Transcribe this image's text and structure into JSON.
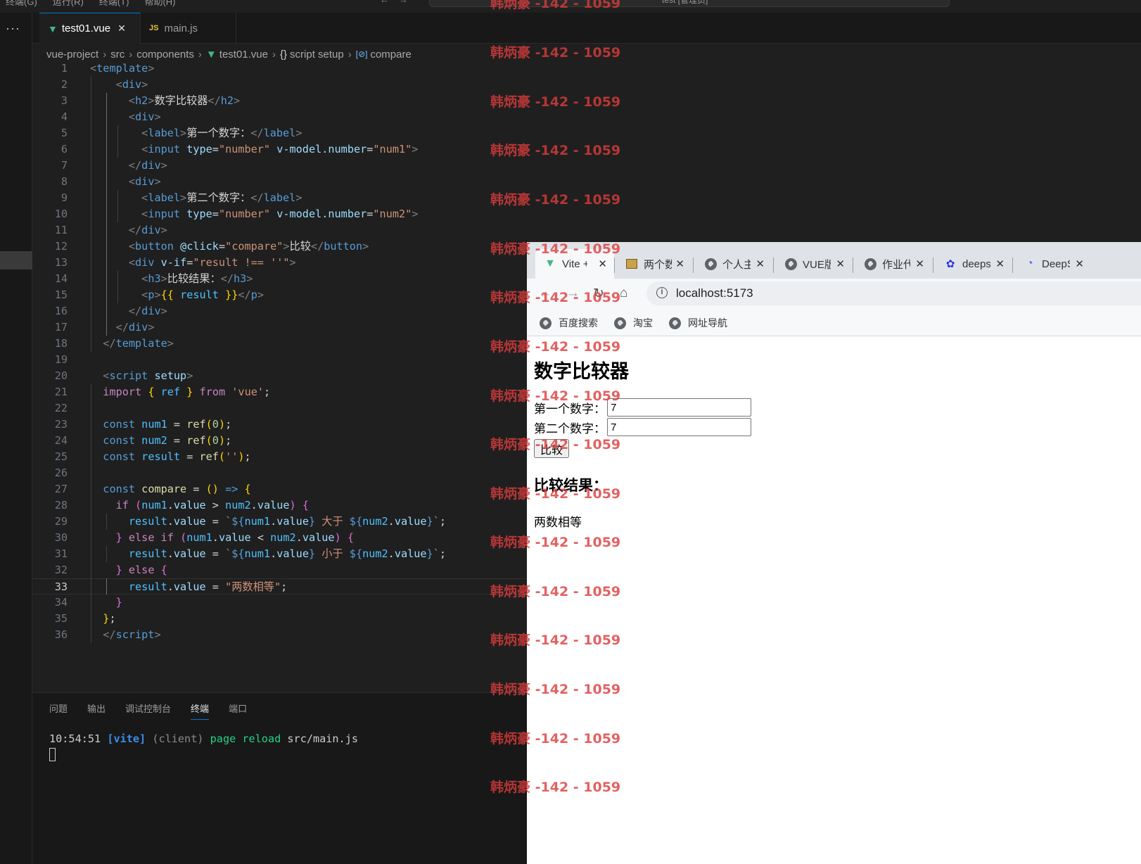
{
  "vscode": {
    "menubar": {
      "items": [
        "终端(G)",
        "运行(R)",
        "终端(T)",
        "帮助(H)"
      ],
      "command_center": "test [管理员]"
    },
    "tabs": [
      {
        "label": "test01.vue",
        "icon": "vue-icon",
        "active": true
      },
      {
        "label": "main.js",
        "icon": "js-icon",
        "active": false
      }
    ],
    "breadcrumb": [
      "vue-project",
      "src",
      "components",
      "test01.vue",
      "script setup",
      "compare"
    ],
    "current_line": 33,
    "panel": {
      "tabs": [
        "问题",
        "输出",
        "调试控制台",
        "终端",
        "端口"
      ],
      "active_tab": "终端",
      "terminal": {
        "time": "10:54:51",
        "tag": "[vite]",
        "client": "(client)",
        "action": "page reload",
        "path": "src/main.js"
      }
    }
  },
  "code": {
    "line_numbers": [
      "1",
      "2",
      "3",
      "4",
      "5",
      "6",
      "7",
      "8",
      "9",
      "10",
      "11",
      "12",
      "13",
      "14",
      "15",
      "16",
      "17",
      "18",
      "19",
      "20",
      "21",
      "22",
      "23",
      "24",
      "25",
      "26",
      "27",
      "28",
      "29",
      "30",
      "31",
      "32",
      "33",
      "34",
      "35",
      "36"
    ],
    "lines": [
      [
        [
          "c-br",
          "<"
        ],
        [
          "c-tag",
          "template"
        ],
        [
          "c-br",
          ">"
        ]
      ],
      [
        [
          "c-txt",
          "    "
        ],
        [
          "c-br",
          "<"
        ],
        [
          "c-tag",
          "div"
        ],
        [
          "c-br",
          ">"
        ]
      ],
      [
        [
          "c-txt",
          "      "
        ],
        [
          "c-br",
          "<"
        ],
        [
          "c-tag",
          "h2"
        ],
        [
          "c-br",
          ">"
        ],
        [
          "c-txt",
          "数字比较器"
        ],
        [
          "c-br",
          "</"
        ],
        [
          "c-tag",
          "h2"
        ],
        [
          "c-br",
          ">"
        ]
      ],
      [
        [
          "c-txt",
          "      "
        ],
        [
          "c-br",
          "<"
        ],
        [
          "c-tag",
          "div"
        ],
        [
          "c-br",
          ">"
        ]
      ],
      [
        [
          "c-txt",
          "        "
        ],
        [
          "c-br",
          "<"
        ],
        [
          "c-tag",
          "label"
        ],
        [
          "c-br",
          ">"
        ],
        [
          "c-txt",
          "第一个数字："
        ],
        [
          "c-br",
          "</"
        ],
        [
          "c-tag",
          "label"
        ],
        [
          "c-br",
          ">"
        ]
      ],
      [
        [
          "c-txt",
          "        "
        ],
        [
          "c-br",
          "<"
        ],
        [
          "c-tag",
          "input"
        ],
        [
          "c-txt",
          " "
        ],
        [
          "c-attr",
          "type"
        ],
        [
          "c-txt",
          "="
        ],
        [
          "c-str",
          "\"number\""
        ],
        [
          "c-txt",
          " "
        ],
        [
          "c-attr",
          "v-model.number"
        ],
        [
          "c-txt",
          "="
        ],
        [
          "c-str",
          "\"num1\""
        ],
        [
          "c-br",
          ">"
        ]
      ],
      [
        [
          "c-txt",
          "      "
        ],
        [
          "c-br",
          "</"
        ],
        [
          "c-tag",
          "div"
        ],
        [
          "c-br",
          ">"
        ]
      ],
      [
        [
          "c-txt",
          "      "
        ],
        [
          "c-br",
          "<"
        ],
        [
          "c-tag",
          "div"
        ],
        [
          "c-br",
          ">"
        ]
      ],
      [
        [
          "c-txt",
          "        "
        ],
        [
          "c-br",
          "<"
        ],
        [
          "c-tag",
          "label"
        ],
        [
          "c-br",
          ">"
        ],
        [
          "c-txt",
          "第二个数字："
        ],
        [
          "c-br",
          "</"
        ],
        [
          "c-tag",
          "label"
        ],
        [
          "c-br",
          ">"
        ]
      ],
      [
        [
          "c-txt",
          "        "
        ],
        [
          "c-br",
          "<"
        ],
        [
          "c-tag",
          "input"
        ],
        [
          "c-txt",
          " "
        ],
        [
          "c-attr",
          "type"
        ],
        [
          "c-txt",
          "="
        ],
        [
          "c-str",
          "\"number\""
        ],
        [
          "c-txt",
          " "
        ],
        [
          "c-attr",
          "v-model.number"
        ],
        [
          "c-txt",
          "="
        ],
        [
          "c-str",
          "\"num2\""
        ],
        [
          "c-br",
          ">"
        ]
      ],
      [
        [
          "c-txt",
          "      "
        ],
        [
          "c-br",
          "</"
        ],
        [
          "c-tag",
          "div"
        ],
        [
          "c-br",
          ">"
        ]
      ],
      [
        [
          "c-txt",
          "      "
        ],
        [
          "c-br",
          "<"
        ],
        [
          "c-tag",
          "button"
        ],
        [
          "c-txt",
          " "
        ],
        [
          "c-attr",
          "@click"
        ],
        [
          "c-txt",
          "="
        ],
        [
          "c-str",
          "\"compare\""
        ],
        [
          "c-br",
          ">"
        ],
        [
          "c-txt",
          "比较"
        ],
        [
          "c-br",
          "</"
        ],
        [
          "c-tag",
          "button"
        ],
        [
          "c-br",
          ">"
        ]
      ],
      [
        [
          "c-txt",
          "      "
        ],
        [
          "c-br",
          "<"
        ],
        [
          "c-tag",
          "div"
        ],
        [
          "c-txt",
          " "
        ],
        [
          "c-attr",
          "v-if"
        ],
        [
          "c-txt",
          "="
        ],
        [
          "c-str",
          "\"result !== ''\""
        ],
        [
          "c-br",
          ">"
        ]
      ],
      [
        [
          "c-txt",
          "        "
        ],
        [
          "c-br",
          "<"
        ],
        [
          "c-tag",
          "h3"
        ],
        [
          "c-br",
          ">"
        ],
        [
          "c-txt",
          "比较结果："
        ],
        [
          "c-br",
          "</"
        ],
        [
          "c-tag",
          "h3"
        ],
        [
          "c-br",
          ">"
        ]
      ],
      [
        [
          "c-txt",
          "        "
        ],
        [
          "c-br",
          "<"
        ],
        [
          "c-tag",
          "p"
        ],
        [
          "c-br",
          ">"
        ],
        [
          "c-y",
          "{{"
        ],
        [
          "c-txt",
          " "
        ],
        [
          "c-var",
          "result"
        ],
        [
          "c-txt",
          " "
        ],
        [
          "c-y",
          "}}"
        ],
        [
          "c-br",
          "</"
        ],
        [
          "c-tag",
          "p"
        ],
        [
          "c-br",
          ">"
        ]
      ],
      [
        [
          "c-txt",
          "      "
        ],
        [
          "c-br",
          "</"
        ],
        [
          "c-tag",
          "div"
        ],
        [
          "c-br",
          ">"
        ]
      ],
      [
        [
          "c-txt",
          "    "
        ],
        [
          "c-br",
          "</"
        ],
        [
          "c-tag",
          "div"
        ],
        [
          "c-br",
          ">"
        ]
      ],
      [
        [
          "c-txt",
          "  "
        ],
        [
          "c-br",
          "</"
        ],
        [
          "c-tag",
          "template"
        ],
        [
          "c-br",
          ">"
        ]
      ],
      [],
      [
        [
          "c-txt",
          "  "
        ],
        [
          "c-br",
          "<"
        ],
        [
          "c-tag",
          "script"
        ],
        [
          "c-txt",
          " "
        ],
        [
          "c-attr",
          "setup"
        ],
        [
          "c-br",
          ">"
        ]
      ],
      [
        [
          "c-txt",
          "  "
        ],
        [
          "c-ctl",
          "import"
        ],
        [
          "c-txt",
          " "
        ],
        [
          "c-y",
          "{"
        ],
        [
          "c-txt",
          " "
        ],
        [
          "c-var",
          "ref"
        ],
        [
          "c-txt",
          " "
        ],
        [
          "c-y",
          "}"
        ],
        [
          "c-txt",
          " "
        ],
        [
          "c-ctl",
          "from"
        ],
        [
          "c-txt",
          " "
        ],
        [
          "c-str",
          "'vue'"
        ],
        [
          "c-txt",
          ";"
        ]
      ],
      [],
      [
        [
          "c-txt",
          "  "
        ],
        [
          "c-kw",
          "const"
        ],
        [
          "c-txt",
          " "
        ],
        [
          "c-var",
          "num1"
        ],
        [
          "c-txt",
          " = "
        ],
        [
          "c-fn",
          "ref"
        ],
        [
          "c-y",
          "("
        ],
        [
          "c-num",
          "0"
        ],
        [
          "c-y",
          ")"
        ],
        [
          "c-txt",
          ";"
        ]
      ],
      [
        [
          "c-txt",
          "  "
        ],
        [
          "c-kw",
          "const"
        ],
        [
          "c-txt",
          " "
        ],
        [
          "c-var",
          "num2"
        ],
        [
          "c-txt",
          " = "
        ],
        [
          "c-fn",
          "ref"
        ],
        [
          "c-y",
          "("
        ],
        [
          "c-num",
          "0"
        ],
        [
          "c-y",
          ")"
        ],
        [
          "c-txt",
          ";"
        ]
      ],
      [
        [
          "c-txt",
          "  "
        ],
        [
          "c-kw",
          "const"
        ],
        [
          "c-txt",
          " "
        ],
        [
          "c-var",
          "result"
        ],
        [
          "c-txt",
          " = "
        ],
        [
          "c-fn",
          "ref"
        ],
        [
          "c-y",
          "("
        ],
        [
          "c-str",
          "''"
        ],
        [
          "c-y",
          ")"
        ],
        [
          "c-txt",
          ";"
        ]
      ],
      [],
      [
        [
          "c-txt",
          "  "
        ],
        [
          "c-kw",
          "const"
        ],
        [
          "c-txt",
          " "
        ],
        [
          "c-fn",
          "compare"
        ],
        [
          "c-txt",
          " = "
        ],
        [
          "c-y",
          "()"
        ],
        [
          "c-txt",
          " "
        ],
        [
          "c-kw",
          "=>"
        ],
        [
          "c-txt",
          " "
        ],
        [
          "c-y",
          "{"
        ]
      ],
      [
        [
          "c-txt",
          "    "
        ],
        [
          "c-ctl",
          "if"
        ],
        [
          "c-txt",
          " "
        ],
        [
          "c-p",
          "("
        ],
        [
          "c-var",
          "num1"
        ],
        [
          "c-txt",
          "."
        ],
        [
          "c-prop",
          "value"
        ],
        [
          "c-txt",
          " > "
        ],
        [
          "c-var",
          "num2"
        ],
        [
          "c-txt",
          "."
        ],
        [
          "c-prop",
          "value"
        ],
        [
          "c-p",
          ")"
        ],
        [
          "c-txt",
          " "
        ],
        [
          "c-p",
          "{"
        ]
      ],
      [
        [
          "c-txt",
          "      "
        ],
        [
          "c-var",
          "result"
        ],
        [
          "c-txt",
          "."
        ],
        [
          "c-prop",
          "value"
        ],
        [
          "c-txt",
          " = "
        ],
        [
          "c-str",
          "`"
        ],
        [
          "c-kw",
          "${"
        ],
        [
          "c-var",
          "num1"
        ],
        [
          "c-txt",
          "."
        ],
        [
          "c-prop",
          "value"
        ],
        [
          "c-kw",
          "}"
        ],
        [
          "c-str",
          " 大于 "
        ],
        [
          "c-kw",
          "${"
        ],
        [
          "c-var",
          "num2"
        ],
        [
          "c-txt",
          "."
        ],
        [
          "c-prop",
          "value"
        ],
        [
          "c-kw",
          "}"
        ],
        [
          "c-str",
          "`"
        ],
        [
          "c-txt",
          ";"
        ]
      ],
      [
        [
          "c-txt",
          "    "
        ],
        [
          "c-p",
          "}"
        ],
        [
          "c-txt",
          " "
        ],
        [
          "c-ctl",
          "else if"
        ],
        [
          "c-txt",
          " "
        ],
        [
          "c-p",
          "("
        ],
        [
          "c-var",
          "num1"
        ],
        [
          "c-txt",
          "."
        ],
        [
          "c-prop",
          "value"
        ],
        [
          "c-txt",
          " < "
        ],
        [
          "c-var",
          "num2"
        ],
        [
          "c-txt",
          "."
        ],
        [
          "c-prop",
          "value"
        ],
        [
          "c-p",
          ")"
        ],
        [
          "c-txt",
          " "
        ],
        [
          "c-p",
          "{"
        ]
      ],
      [
        [
          "c-txt",
          "      "
        ],
        [
          "c-var",
          "result"
        ],
        [
          "c-txt",
          "."
        ],
        [
          "c-prop",
          "value"
        ],
        [
          "c-txt",
          " = "
        ],
        [
          "c-str",
          "`"
        ],
        [
          "c-kw",
          "${"
        ],
        [
          "c-var",
          "num1"
        ],
        [
          "c-txt",
          "."
        ],
        [
          "c-prop",
          "value"
        ],
        [
          "c-kw",
          "}"
        ],
        [
          "c-str",
          " 小于 "
        ],
        [
          "c-kw",
          "${"
        ],
        [
          "c-var",
          "num2"
        ],
        [
          "c-txt",
          "."
        ],
        [
          "c-prop",
          "value"
        ],
        [
          "c-kw",
          "}"
        ],
        [
          "c-str",
          "`"
        ],
        [
          "c-txt",
          ";"
        ]
      ],
      [
        [
          "c-txt",
          "    "
        ],
        [
          "c-p",
          "}"
        ],
        [
          "c-txt",
          " "
        ],
        [
          "c-ctl",
          "else"
        ],
        [
          "c-txt",
          " "
        ],
        [
          "c-p",
          "{"
        ]
      ],
      [
        [
          "c-txt",
          "      "
        ],
        [
          "c-var",
          "result"
        ],
        [
          "c-txt",
          "."
        ],
        [
          "c-prop",
          "value"
        ],
        [
          "c-txt",
          " = "
        ],
        [
          "c-str",
          "\"两数相等\""
        ],
        [
          "c-txt",
          ";"
        ]
      ],
      [
        [
          "c-txt",
          "    "
        ],
        [
          "c-p",
          "}"
        ]
      ],
      [
        [
          "c-txt",
          "  "
        ],
        [
          "c-y",
          "}"
        ],
        [
          "c-txt",
          ";"
        ]
      ],
      [
        [
          "c-txt",
          "  "
        ],
        [
          "c-br",
          "</"
        ],
        [
          "c-tag",
          "script"
        ],
        [
          "c-br",
          ">"
        ]
      ]
    ]
  },
  "browser": {
    "tabs": [
      {
        "label": "Vite + Vue",
        "icon": "vite-icon",
        "active": true
      },
      {
        "label": "两个数比较",
        "icon": "image-icon",
        "active": false
      },
      {
        "label": "个人主页",
        "icon": "globe-icon",
        "active": false
      },
      {
        "label": "VUE版本",
        "icon": "globe-icon",
        "active": false
      },
      {
        "label": "作业代码",
        "icon": "globe-icon",
        "active": false
      },
      {
        "label": "deepseek",
        "icon": "baidu-icon",
        "active": false
      },
      {
        "label": "DeepSeek",
        "icon": "deepseek-icon",
        "active": false
      }
    ],
    "url": "localhost:5173",
    "bookmarks": [
      "百度搜索",
      "淘宝",
      "网址导航"
    ],
    "page": {
      "title": "数字比较器",
      "label1": "第一个数字：",
      "value1": "7",
      "label2": "第二个数字：",
      "value2": "7",
      "button": "比较",
      "result_heading": "比较结果：",
      "result": "两数相等"
    }
  },
  "watermark": {
    "text": "韩炳豪 -142 - 1059",
    "color": "#dc3c3c"
  }
}
